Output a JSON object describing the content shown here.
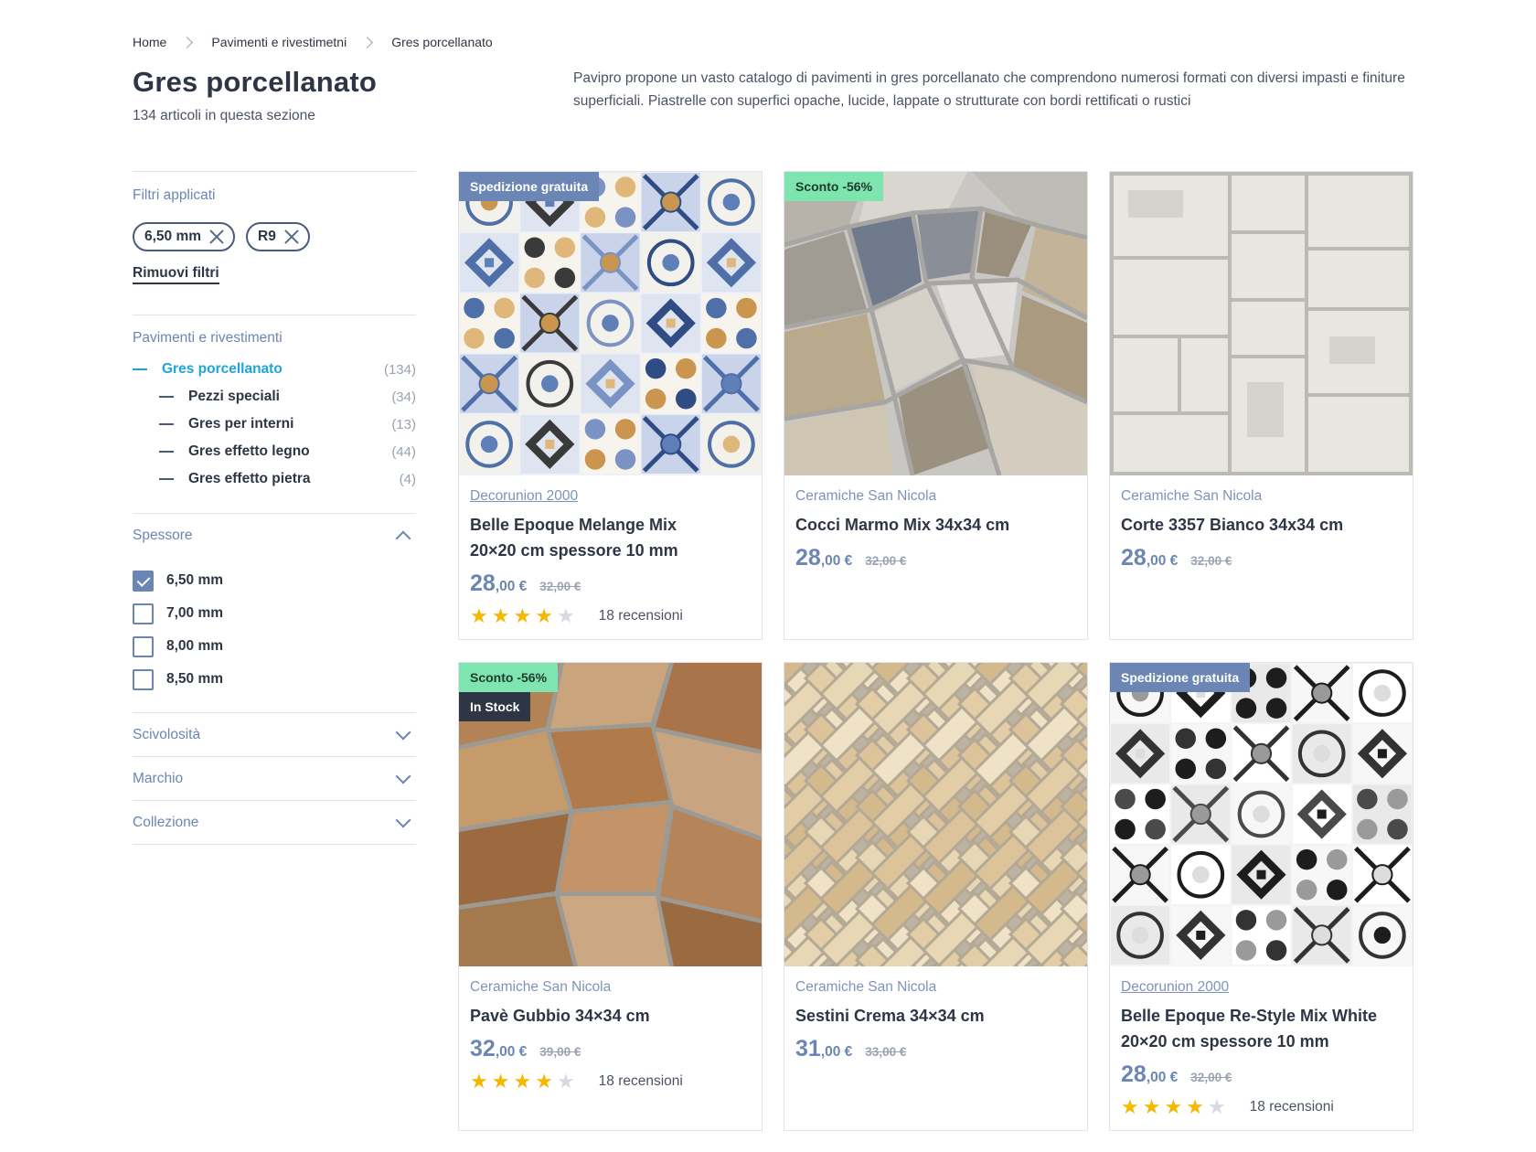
{
  "breadcrumb": [
    "Home",
    "Pavimenti e rivestimetni",
    "Gres porcellanato"
  ],
  "page": {
    "title": "Gres porcellanato",
    "subtitle": "134 articoli in questa sezione",
    "description": "Pavipro propone un vasto catalogo di pavimenti in gres porcellanato che comprendono numerosi formati con diversi impasti e finiture superficiali.  Piastrelle con superfici opache, lucide, lappate o strutturate con bordi rettificati o rustici"
  },
  "filters": {
    "applied_heading": "Filtri applicati",
    "chips": [
      "6,50 mm",
      "R9"
    ],
    "remove_label": "Rimuovi filtri",
    "category_heading": "Pavimenti e rivestimenti",
    "categories": [
      {
        "label": "Gres porcellanato",
        "count": "(134)"
      },
      {
        "label": "Pezzi speciali",
        "count": "(34)"
      },
      {
        "label": "Gres per interni",
        "count": "(13)"
      },
      {
        "label": "Gres effetto legno",
        "count": "(44)"
      },
      {
        "label": "Gres effetto pietra",
        "count": "(4)"
      }
    ],
    "thickness_heading": "Spessore",
    "thickness_options": [
      {
        "label": "6,50 mm",
        "checked": true
      },
      {
        "label": "7,00 mm",
        "checked": false
      },
      {
        "label": "8,00 mm",
        "checked": false
      },
      {
        "label": "8,50 mm",
        "checked": false
      }
    ],
    "collapsed": [
      "Scivolosità",
      "Marchio",
      "Collezione"
    ]
  },
  "products": [
    {
      "badges": [
        "Spedizione gratuita"
      ],
      "brand": "Decorunion 2000",
      "name_line1": "Belle Epoque Melange Mix",
      "name_line2": "20×20 cm spessore 10 mm",
      "price_int": "28",
      "price_dec": ",00 €",
      "price_old": "32,00 €",
      "rating": 4,
      "reviews": "18 recensioni"
    },
    {
      "badges": [
        "Sconto -56%"
      ],
      "brand": "Ceramiche San Nicola",
      "name_line1": "Cocci Marmo Mix 34x34 cm",
      "name_line2": "",
      "price_int": "28",
      "price_dec": ",00 €",
      "price_old": "32,00 €"
    },
    {
      "badges": [],
      "brand": "Ceramiche San Nicola",
      "name_line1": "Corte 3357 Bianco 34x34 cm",
      "name_line2": "",
      "price_int": "28",
      "price_dec": ",00 €",
      "price_old": "32,00 €"
    },
    {
      "badges": [
        "Sconto -56%",
        "In Stock"
      ],
      "brand": "Ceramiche San Nicola",
      "name_line1": "Pavè Gubbio 34×34 cm",
      "name_line2": "",
      "price_int": "32",
      "price_dec": ",00 €",
      "price_old": "39,00 €",
      "rating": 4,
      "reviews": "18 recensioni"
    },
    {
      "badges": [],
      "brand": "Ceramiche San Nicola",
      "name_line1": "Sestini Crema 34×34 cm",
      "name_line2": "",
      "price_int": "31",
      "price_dec": ",00 €",
      "price_old": "33,00 €"
    },
    {
      "badges": [
        "Spedizione gratuita"
      ],
      "brand": "Decorunion 2000",
      "name_line1": "Belle Epoque Re-Style Mix White",
      "name_line2": "20×20 cm spessore 10 mm",
      "price_int": "28",
      "price_dec": ",00 €",
      "price_old": "32,00 €",
      "rating": 4,
      "reviews": "18 recensioni"
    }
  ],
  "colors": {
    "accent": "#6b86b4",
    "active": "#1ea4d9",
    "discount": "#7ee5b0",
    "star": "#f5b800",
    "dark": "#2e3645"
  },
  "icons": [
    "chevron-right-icon",
    "close-icon",
    "check-icon",
    "chevron-up-icon",
    "chevron-down-icon",
    "star-icon"
  ]
}
